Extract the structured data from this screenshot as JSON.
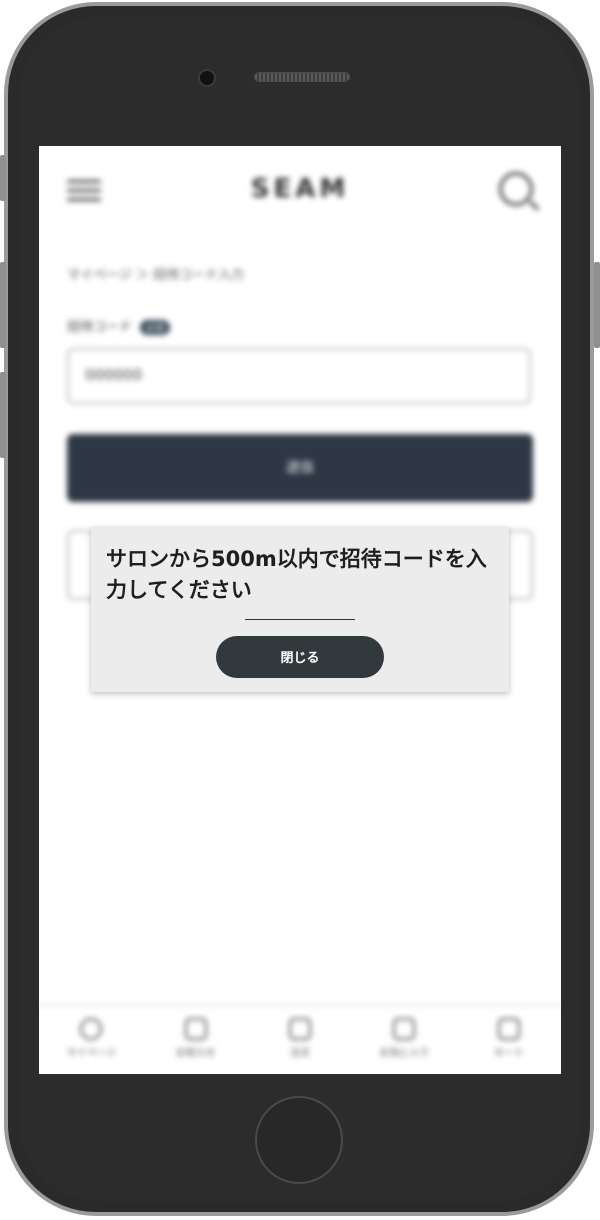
{
  "header": {
    "logo": "SEAM"
  },
  "breadcrumb": {
    "text": "マイページ ＞ 招待コード入力"
  },
  "form": {
    "label": "招待コード",
    "required_badge": "必須",
    "input_value": "000000",
    "submit_label": "送信"
  },
  "bottom_nav": {
    "items": [
      {
        "label": "マイページ",
        "icon": "user-icon"
      },
      {
        "label": "お知らせ",
        "icon": "bell-icon"
      },
      {
        "label": "注文",
        "icon": "list-icon"
      },
      {
        "label": "お気に入り",
        "icon": "heart-icon"
      },
      {
        "label": "カート",
        "icon": "cart-icon"
      }
    ]
  },
  "modal": {
    "message": "サロンから500m以内で招待コードを入力してください",
    "close_label": "閉じる"
  },
  "colors": {
    "phone_body": "#2a2a2a",
    "submit_button": "#2d3745",
    "modal_bg": "#ececec",
    "close_button": "#32393c"
  }
}
